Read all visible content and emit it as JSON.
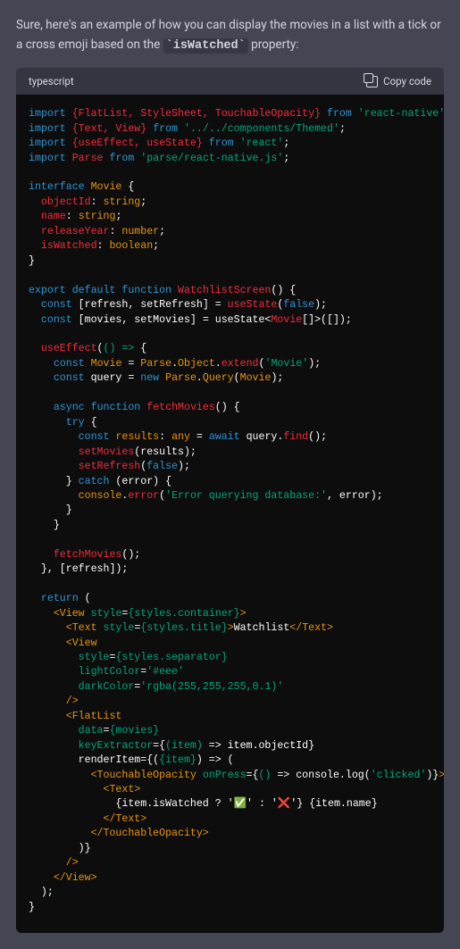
{
  "message": {
    "intro_prefix": "Sure, here's an example of how you can display the movies in a list with a tick or a cross emoji based on the ",
    "intro_code": "`isWatched`",
    "intro_suffix": " property:"
  },
  "codeblock": {
    "language": "typescript",
    "copy_label": "Copy code",
    "code": {
      "imports": {
        "rn_items": "{FlatList, StyleSheet, TouchableOpacity}",
        "rn_from": "'react-native'",
        "themed_items": "{Text, View}",
        "themed_from": "'../../components/Themed'",
        "react_items": "{useEffect, useState}",
        "react_from": "'react'",
        "parse_default": "Parse",
        "parse_from": "'parse/react-native.js'"
      },
      "interface": {
        "name": "Movie",
        "fields": [
          {
            "name": "objectId",
            "type": "string"
          },
          {
            "name": "name",
            "type": "string"
          },
          {
            "name": "releaseYear",
            "type": "number"
          },
          {
            "name": "isWatched",
            "type": "boolean"
          }
        ]
      },
      "component": {
        "export_kw": "export",
        "default_kw": "default",
        "function_kw": "function",
        "name": "WatchlistScreen",
        "state_refresh": {
          "names": "[refresh, setRefresh]",
          "hook": "useState",
          "init": "false"
        },
        "state_movies": {
          "names": "[movies, setMovies]",
          "hook": "useState",
          "generic": "Movie",
          "init": "[]"
        },
        "effect": {
          "hook": "useEffect",
          "movie_extend": "'Movie'",
          "fetch_name": "fetchMovies",
          "find_call": "find",
          "error_msg": "'Error querying database:'",
          "dep": "[refresh]"
        },
        "jsx": {
          "title_text": "Watchlist",
          "lightColor": "'#eee'",
          "darkColor": "'rgba(255,255,255,0.1)'",
          "onPress_log": "'clicked'",
          "tick_emoji": "✅",
          "cross_emoji": "❌"
        }
      }
    }
  },
  "chart_data": null
}
